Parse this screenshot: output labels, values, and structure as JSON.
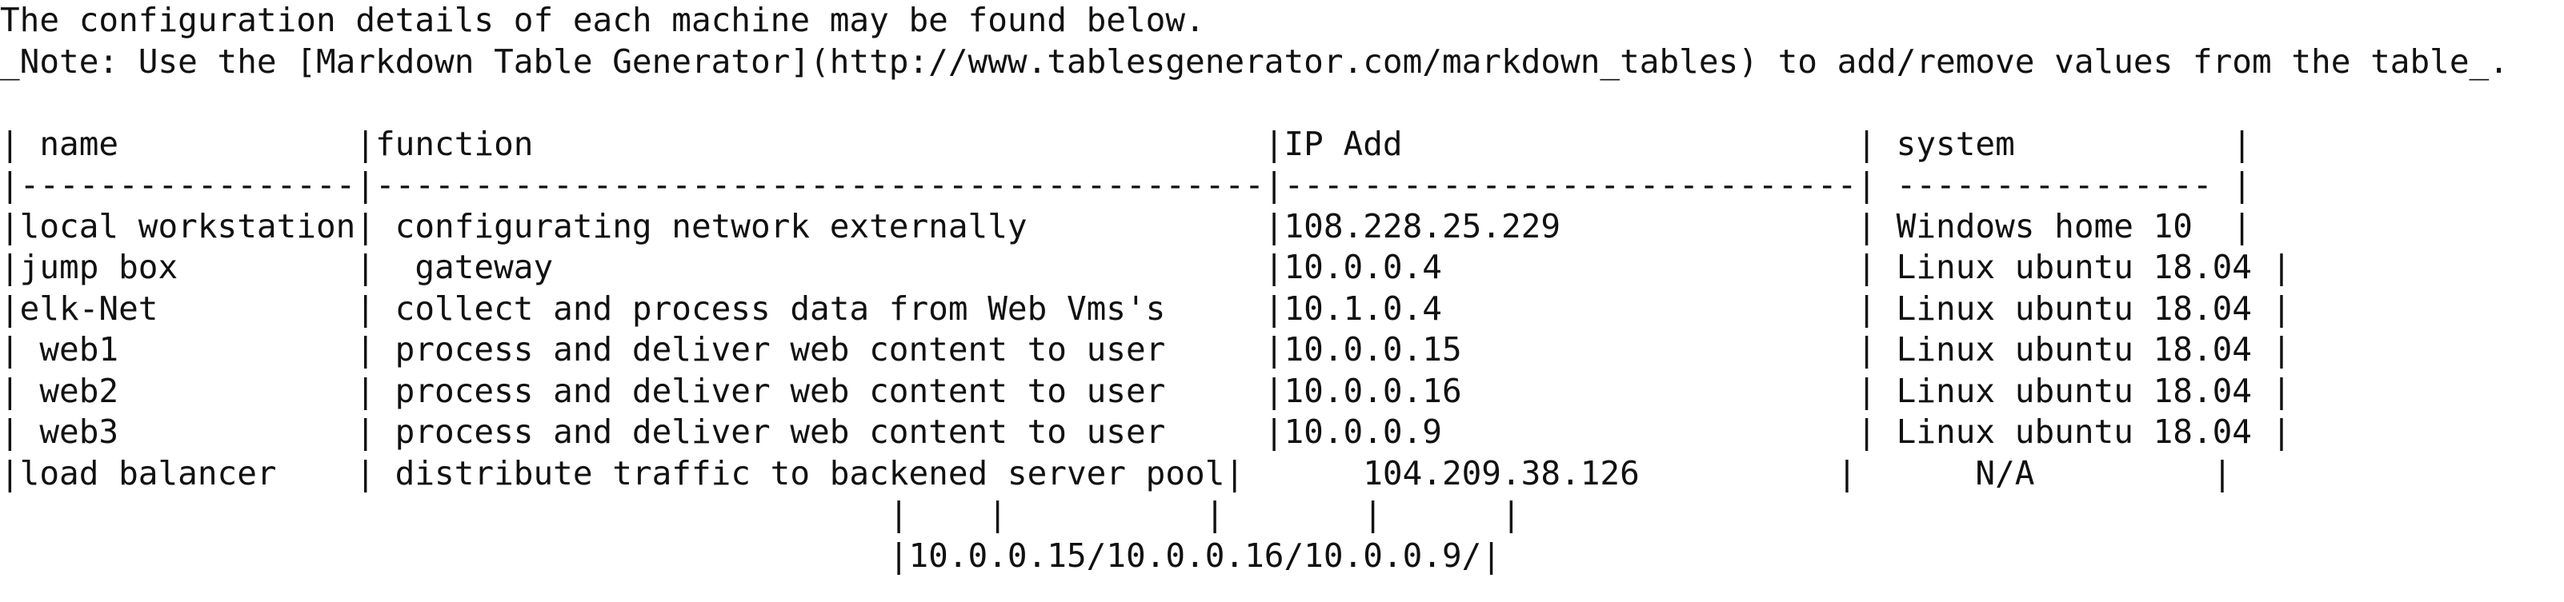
{
  "document": {
    "lines": [
      "The configuration details of each machine may be found below.",
      "_Note: Use the [Markdown Table Generator](http://www.tablesgenerator.com/markdown_tables) to add/remove values from the table_.",
      "",
      "| name            |function                                     |IP Add                       | system           |",
      "|-----------------|---------------------------------------------|-----------------------------| ---------------- |",
      "|local workstation| configurating network externally            |108.228.25.229               | Windows home 10  |",
      "|jump box         |  gateway                                    |10.0.0.4                     | Linux ubuntu 18.04 |",
      "|elk-Net          | collect and process data from Web Vms's     |10.1.0.4                     | Linux ubuntu 18.04 |",
      "| web1            | process and deliver web content to user     |10.0.0.15                    | Linux ubuntu 18.04 |",
      "| web2            | process and deliver web content to user     |10.0.0.16                    | Linux ubuntu 18.04 |",
      "| web3            | process and deliver web content to user     |10.0.0.9                     | Linux ubuntu 18.04 |",
      "|load balancer    | distribute traffic to backened server pool|      104.209.38.126          |      N/A         |",
      "                                             |    |          |       |      |",
      "                                             |10.0.0.15/10.0.0.16/10.0.0.9/|"
    ]
  }
}
